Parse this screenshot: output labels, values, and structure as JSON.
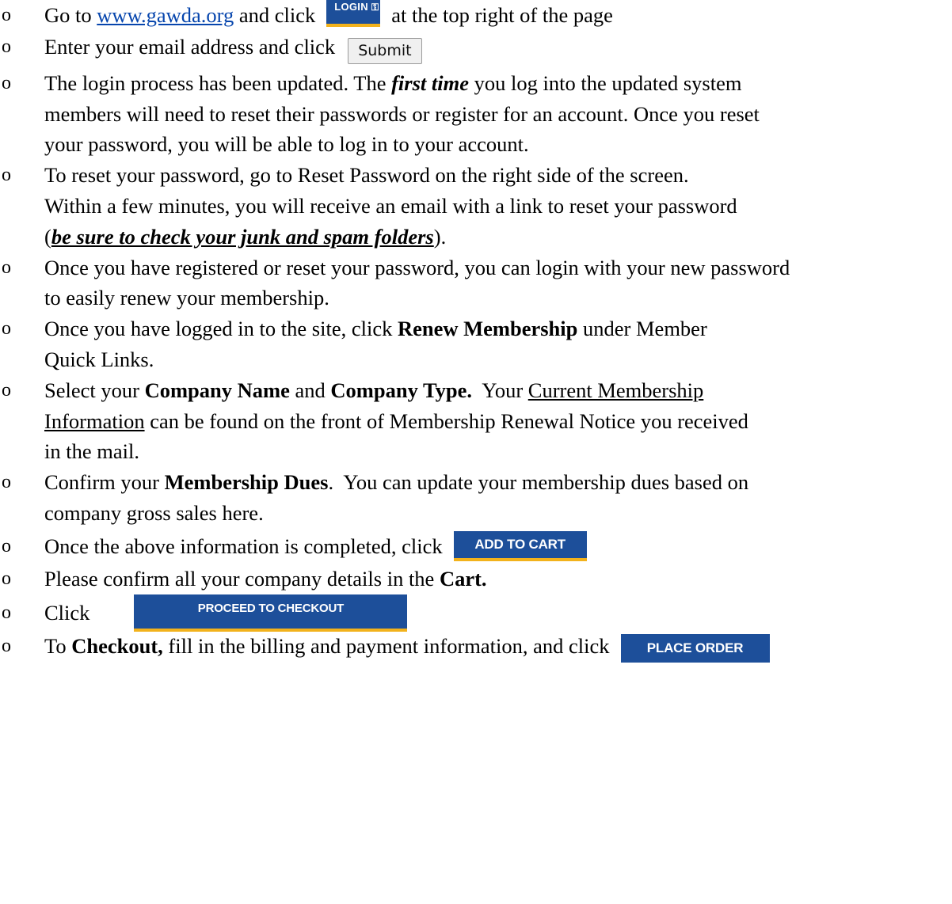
{
  "bullet_char": "o",
  "items": [
    {
      "a": "Go to ",
      "link": "www.gawda.org",
      "b": " and click",
      "button": "LOGIN",
      "c": "at the top right of the page"
    },
    {
      "a": "Enter your email address and click",
      "button": "Submit"
    },
    {
      "a": "The login process has been updated.  The ",
      "em": "first time",
      "b": " you log into the updated system",
      "line2": "members will need to reset their passwords or register for an account.  Once you reset",
      "line3": "your password, you will be able to log in to your account."
    },
    {
      "line1": "To reset your password, go to Reset Password on the right side of the screen.",
      "line2": "Within a few minutes, you will receive an email with a link to reset your password",
      "open": "(",
      "em": "be sure to check your junk and spam folders",
      "close": ")."
    },
    {
      "line1": "Once you have registered or reset your password, you can login with your new password",
      "line2": "to easily renew your membership."
    },
    {
      "a": "Once you have logged in to the site, click ",
      "bold": "Renew Membership",
      "b": " under Member",
      "line2": "Quick Links."
    },
    {
      "a": "Select your ",
      "bold1": "Company Name",
      "b": " and ",
      "bold2": "Company Type.",
      "c": "  Your ",
      "u1": "Current Membership",
      "u2": "Information",
      "d": " can be found on the front of Membership Renewal Notice you received",
      "line3": "in the mail."
    },
    {
      "a": "Confirm your ",
      "bold": "Membership Dues",
      "b": ".  You can update your membership dues based on",
      "line2": "company gross sales here."
    },
    {
      "a": "Once the above information is completed, click",
      "button": "ADD TO CART"
    },
    {
      "a": "Please confirm all your company details in the ",
      "bold": "Cart."
    },
    {
      "a": "Click",
      "button": "PROCEED TO CHECKOUT"
    },
    {
      "a": "To ",
      "bold": "Checkout,",
      "b": " fill in the billing and payment information, and click",
      "button": "PLACE ORDER"
    }
  ],
  "colors": {
    "button_blue": "#1d4f9a",
    "button_underline": "#f2b21c",
    "link": "#0645ad"
  }
}
